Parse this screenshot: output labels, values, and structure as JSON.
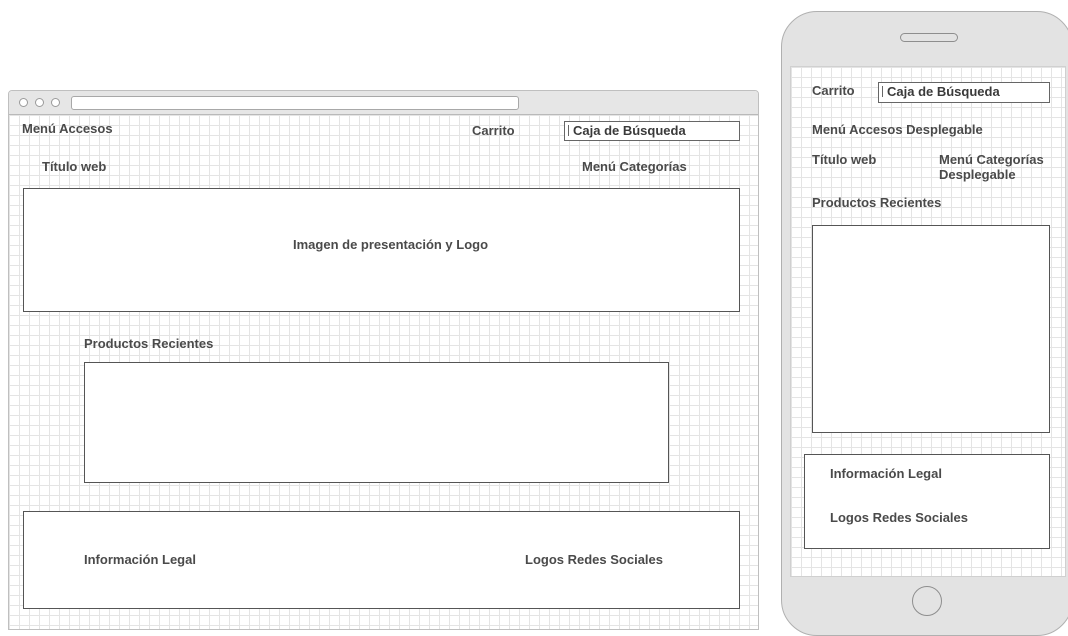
{
  "desktop": {
    "menu_accesos": "Menú Accesos",
    "carrito": "Carrito",
    "search_placeholder": "Caja de Búsqueda",
    "titulo_web": "Título web",
    "menu_categorias": "Menú Categorías",
    "hero": "Imagen de presentación y Logo",
    "productos_recientes": "Productos Recientes",
    "informacion_legal": "Información Legal",
    "logos_redes": "Logos Redes Sociales"
  },
  "mobile": {
    "carrito": "Carrito",
    "search_placeholder": "Caja de Búsqueda",
    "menu_accesos": "Menú Accesos Desplegable",
    "titulo_web": "Título web",
    "menu_categorias_line1": "Menú Categorías",
    "menu_categorias_line2": "Desplegable",
    "productos_recientes": "Productos Recientes",
    "informacion_legal": "Información Legal",
    "logos_redes": "Logos Redes Sociales"
  }
}
